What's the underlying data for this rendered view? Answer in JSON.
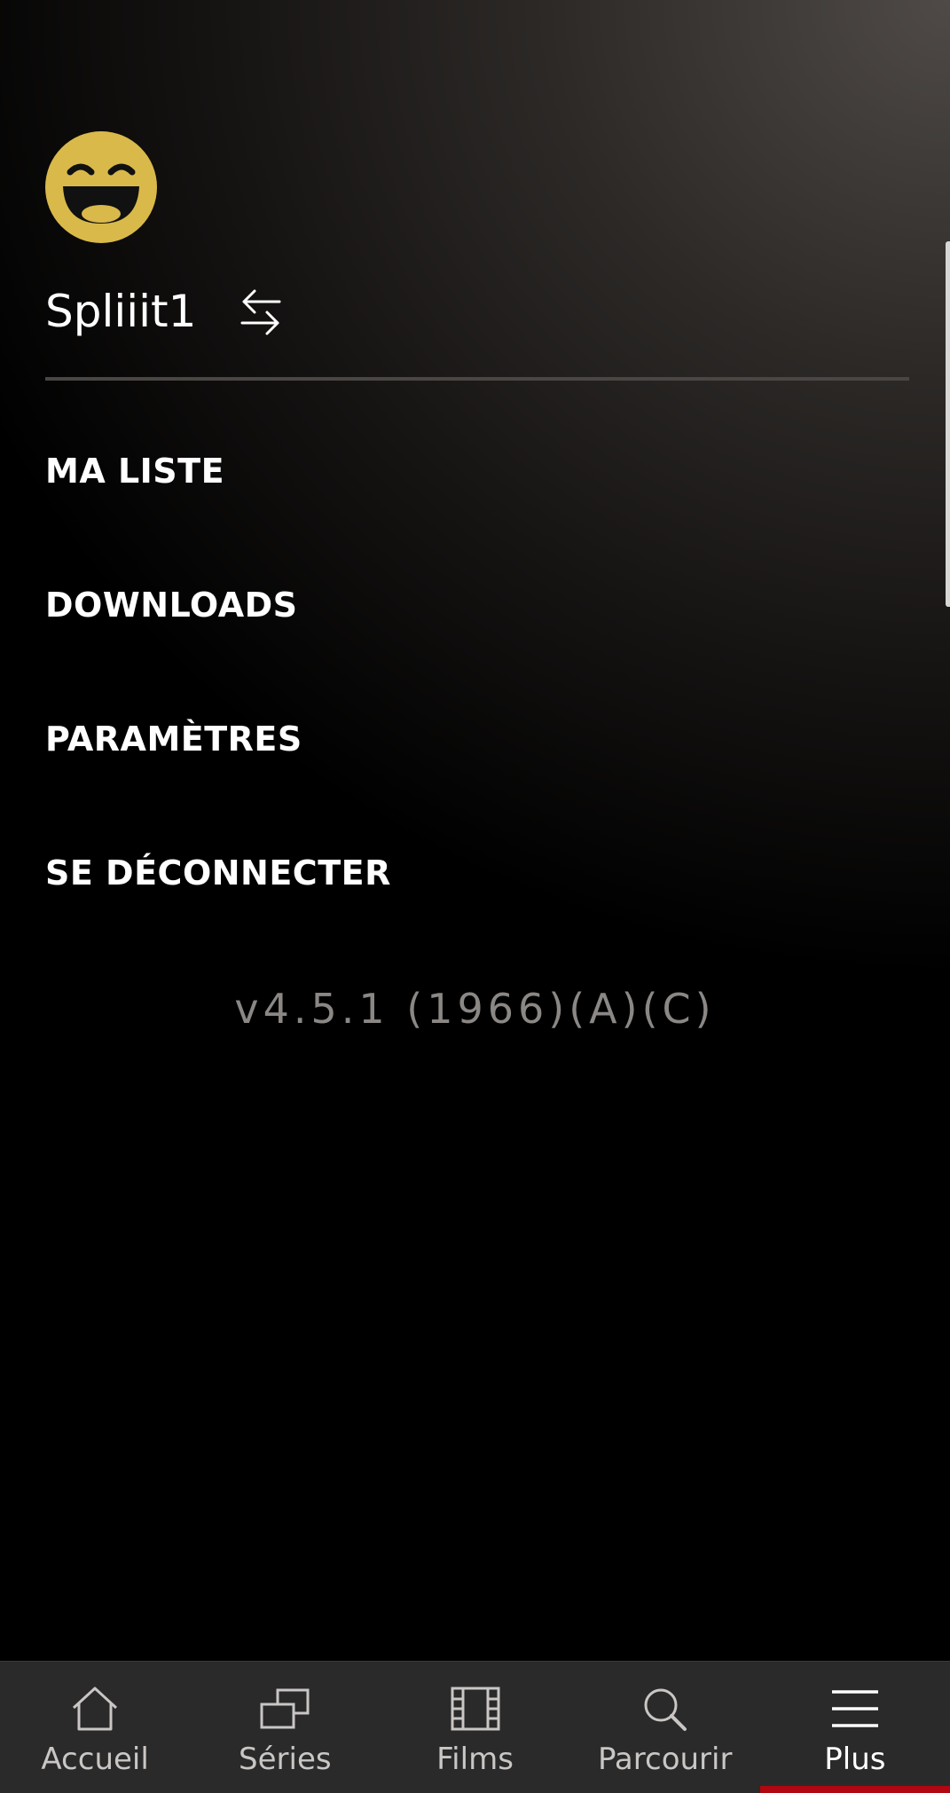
{
  "profile": {
    "name": "Spliiit1",
    "avatar": "laughing-face-icon",
    "avatar_color": "#d9b94a",
    "switch_icon": "switch-profile-icon"
  },
  "menu": {
    "items": [
      {
        "label": "MA LISTE"
      },
      {
        "label": "DOWNLOADS"
      },
      {
        "label": "PARAMÈTRES"
      },
      {
        "label": "SE DÉCONNECTER"
      }
    ]
  },
  "version": "v4.5.1 (1966)(A)(C)",
  "tabbar": {
    "accent_color": "#b00710",
    "tabs": [
      {
        "label": "Accueil",
        "icon": "home-icon",
        "active": false
      },
      {
        "label": "Séries",
        "icon": "series-icon",
        "active": false
      },
      {
        "label": "Films",
        "icon": "film-icon",
        "active": false
      },
      {
        "label": "Parcourir",
        "icon": "search-icon",
        "active": false
      },
      {
        "label": "Plus",
        "icon": "menu-icon",
        "active": true
      }
    ]
  }
}
